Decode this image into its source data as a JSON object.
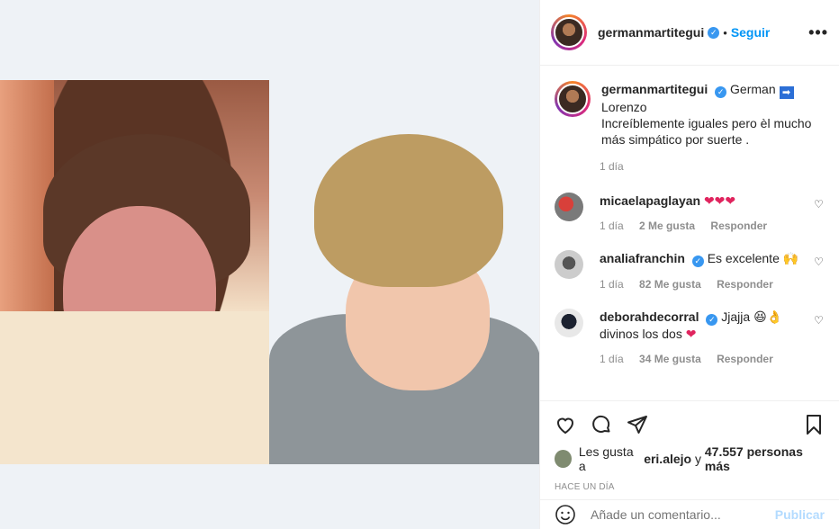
{
  "header": {
    "username": "germanmartitegui",
    "follow_label": "Seguir",
    "dot": "•",
    "more_label": "•••"
  },
  "caption": {
    "username": "germanmartitegui",
    "line1_word": "German",
    "arrow": "➡",
    "name2": "Lorenzo",
    "text": "Increíblemente iguales pero èl mucho más simpático por suerte .",
    "time": "1 día"
  },
  "comments": [
    {
      "username": "micaelapaglayan",
      "text": "",
      "emoji": "❤❤❤",
      "time": "1 día",
      "likes": "2 Me gusta",
      "reply": "Responder"
    },
    {
      "username": "analiafranchin",
      "text": "Es excelente",
      "emoji": "🙌",
      "time": "1 día",
      "likes": "82 Me gusta",
      "reply": "Responder"
    },
    {
      "username": "deborahdecorral",
      "text": "Jjajja",
      "emoji": "😆👌",
      "text2": "divinos los dos",
      "emoji2": "❤",
      "time": "1 día",
      "likes": "34 Me gusta",
      "reply": "Responder"
    }
  ],
  "actions": {
    "likes_prefix": "Les gusta a",
    "likes_user": "eri.alejo",
    "likes_and": "y",
    "likes_count": "47.557 personas más",
    "ago": "HACE UN DÍA"
  },
  "comment_box": {
    "placeholder": "Añade un comentario...",
    "publish_label": "Publicar"
  },
  "colors": {
    "accent": "#0095f6",
    "verified": "#3897f0",
    "heart": "#e0245e"
  }
}
